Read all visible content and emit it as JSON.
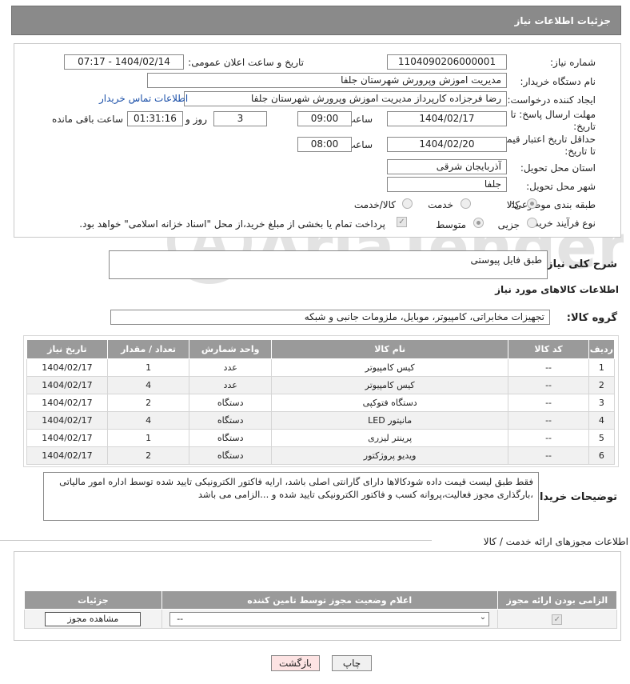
{
  "header": {
    "title": "جزئیات اطلاعات نیاز"
  },
  "need_number": {
    "label": "شماره نیاز:",
    "value": "1104090206000001"
  },
  "announce": {
    "label": "تاریخ و ساعت اعلان عمومی:",
    "value": "1404/02/14 - 07:17"
  },
  "buyer_org": {
    "label": "نام دستگاه خریدار:",
    "value": "مدیریت اموزش وپرورش شهرستان جلفا"
  },
  "requester": {
    "label": "ایجاد کننده درخواست:",
    "value": "رضا فرجزاده کارپرداز مدیریت اموزش وپرورش شهرستان جلفا",
    "contact_link": "اطلاعات تماس خریدار"
  },
  "reply_deadline": {
    "label_line1": "مهلت ارسال پاسخ: تا",
    "label_line2": "تاریخ:",
    "date": "1404/02/17",
    "time_label": "ساعت",
    "time": "09:00",
    "days": "3",
    "days_label": "روز و",
    "remaining": "01:31:16",
    "remaining_label": "ساعت باقی مانده"
  },
  "price_validity": {
    "label_line1": "حداقل تاریخ اعتبار قیمت:",
    "label_line2": "تا تاریخ:",
    "date": "1404/02/20",
    "time_label": "ساعت",
    "time": "08:00"
  },
  "province": {
    "label": "استان محل تحویل:",
    "value": "آذربایجان شرقی"
  },
  "city": {
    "label": "شهر محل تحویل:",
    "value": "جلفا"
  },
  "category": {
    "label": "طبقه بندی موضوعی:",
    "options": [
      "کالا",
      "خدمت",
      "کالا/خدمت"
    ],
    "selected": "کالا"
  },
  "process": {
    "label": "نوع فرآیند خرید :",
    "options": [
      "جزیی",
      "متوسط"
    ],
    "selected": "متوسط",
    "payment_note": "پرداخت تمام یا بخشی از مبلغ خرید،از محل \"اسناد خزانه اسلامی\" خواهد بود."
  },
  "description": {
    "label": "شرح کلی نیاز:",
    "value": "طبق فایل پیوستی"
  },
  "goods_section": {
    "title": "اطلاعات کالاهای مورد نیاز"
  },
  "goods_group": {
    "label": "گروه کالا:",
    "value": "تجهیزات مخابراتی، کامپیوتر، موبایل، ملزومات جانبی و شبکه"
  },
  "table": {
    "headers": [
      "ردیف",
      "کد کالا",
      "نام کالا",
      "واحد شمارش",
      "تعداد / مقدار",
      "تاریخ نیاز"
    ],
    "rows": [
      [
        "1",
        "--",
        "کیس کامپیوتر",
        "عدد",
        "1",
        "1404/02/17"
      ],
      [
        "2",
        "--",
        "کیس کامپیوتر",
        "عدد",
        "4",
        "1404/02/17"
      ],
      [
        "3",
        "--",
        "دستگاه فتوکپی",
        "دستگاه",
        "2",
        "1404/02/17"
      ],
      [
        "4",
        "--",
        "مانیتور LED",
        "دستگاه",
        "4",
        "1404/02/17"
      ],
      [
        "5",
        "--",
        "پرینتر لیزری",
        "دستگاه",
        "1",
        "1404/02/17"
      ],
      [
        "6",
        "--",
        "ویدیو پروژکتور",
        "دستگاه",
        "2",
        "1404/02/17"
      ]
    ]
  },
  "buyer_notes": {
    "label": "توضیحات خریدار:",
    "value": "فقط طبق لیست قیمت داده شودکالاها دارای گارانتی اصلی باشد، ارایه فاکتور الکترونیکی تایید شده توسط اداره امور مالیاتی ،بارگذاری مجوز فعالیت،پروانه کسب و فاکتور الکترونیکی تایید شده و ...الزامی می باشد"
  },
  "permits": {
    "title": "اطلاعات مجوزهای ارائه خدمت / کالا",
    "headers": [
      "الزامی بودن ارائه مجوز",
      "اعلام وضعیت مجوز توسط تامین کننده",
      "جزئیات"
    ],
    "select_value": "--",
    "view_button": "مشاهده مجوز"
  },
  "buttons": {
    "print": "چاپ",
    "back": "بازگشت"
  },
  "watermark": {
    "text": "AriaTender.neT"
  },
  "colors": {
    "header_bg": "#8a8a8a",
    "table_header_bg": "#9a9a9a",
    "link": "#1a4fa8",
    "back_button_bg": "#fde3e3"
  }
}
